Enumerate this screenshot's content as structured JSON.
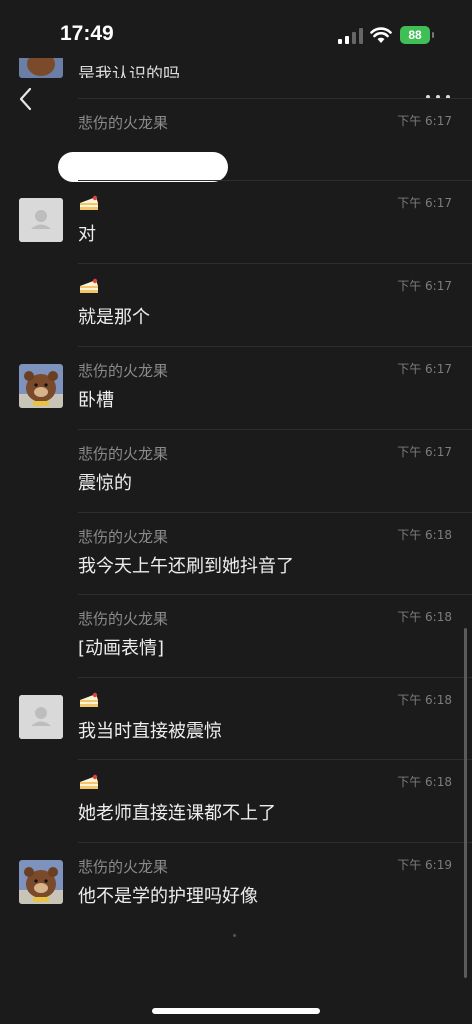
{
  "status_bar": {
    "time": "17:49",
    "battery": "88"
  },
  "top_partial_text": "是我认识的吗",
  "messages": [
    {
      "sender": "悲伤的火龙果",
      "time": "下午 6:17",
      "text": "",
      "avatar": "none",
      "redacted": true
    },
    {
      "sender": "",
      "sender_emoji": "🍰",
      "time": "下午 6:17",
      "text": "对",
      "avatar": "grey"
    },
    {
      "sender": "",
      "sender_emoji": "🍰",
      "time": "下午 6:17",
      "text": "就是那个",
      "avatar": "none"
    },
    {
      "sender": "悲伤的火龙果",
      "time": "下午 6:17",
      "text": "卧槽",
      "avatar": "bear"
    },
    {
      "sender": "悲伤的火龙果",
      "time": "下午 6:17",
      "text": "震惊的",
      "avatar": "none"
    },
    {
      "sender": "悲伤的火龙果",
      "time": "下午 6:18",
      "text": "我今天上午还刷到她抖音了",
      "avatar": "none"
    },
    {
      "sender": "悲伤的火龙果",
      "time": "下午 6:18",
      "text": "[动画表情]",
      "avatar": "none"
    },
    {
      "sender": "",
      "sender_emoji": "🍰",
      "time": "下午 6:18",
      "text": "我当时直接被震惊",
      "avatar": "grey"
    },
    {
      "sender": "",
      "sender_emoji": "🍰",
      "time": "下午 6:18",
      "text": "她老师直接连课都不上了",
      "avatar": "none"
    },
    {
      "sender": "悲伤的火龙果",
      "time": "下午 6:19",
      "text": "他不是学的护理吗好像",
      "avatar": "bear"
    }
  ]
}
